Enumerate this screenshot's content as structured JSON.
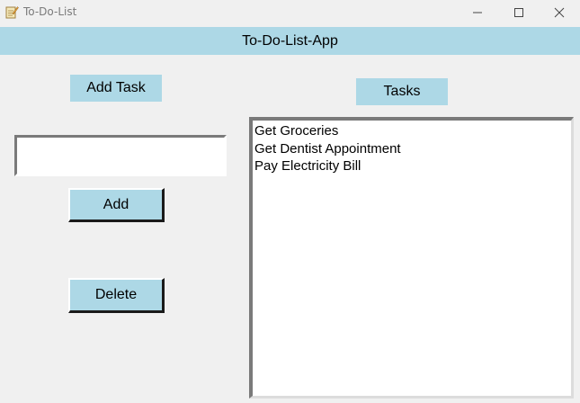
{
  "window": {
    "title": "To-Do-List",
    "icon": "notepad-pencil-icon",
    "controls": [
      "minimize-icon",
      "maximize-icon",
      "close-icon"
    ]
  },
  "header": {
    "title": "To-Do-List-App"
  },
  "left_panel": {
    "add_task_label": "Add Task",
    "entry_value": "",
    "add_button_label": "Add",
    "delete_button_label": "Delete"
  },
  "right_panel": {
    "tasks_label": "Tasks",
    "tasks": [
      "Get Groceries",
      "Get Dentist Appointment",
      "Pay Electricity Bill"
    ]
  },
  "colors": {
    "accent": "#add8e6",
    "background": "#f0f0f0"
  }
}
